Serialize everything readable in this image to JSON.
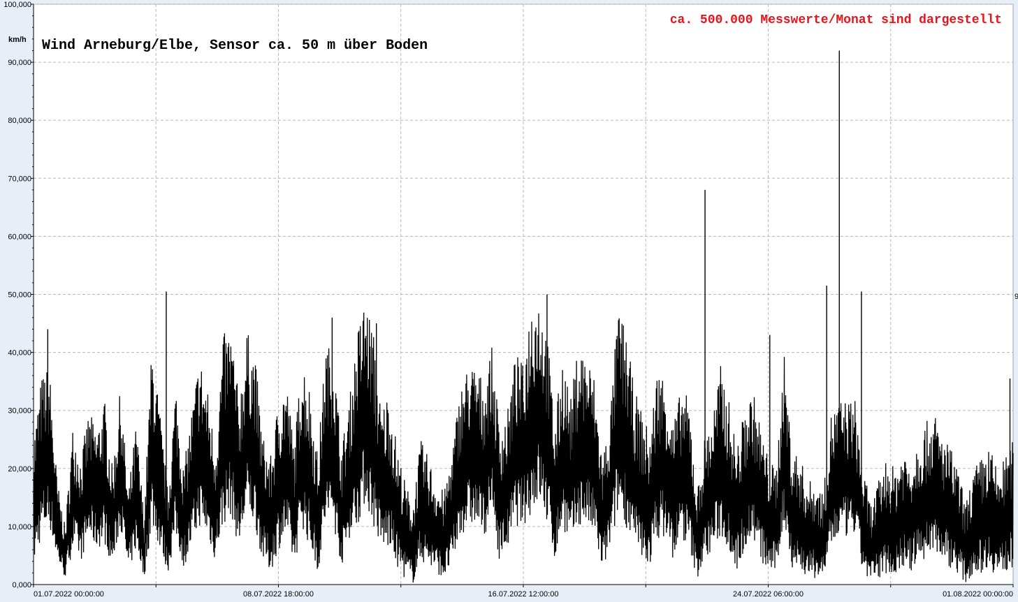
{
  "chart_data": {
    "type": "area",
    "title": "Wind  Arneburg/Elbe, Sensor ca. 50 m über Boden",
    "annotation": "ca. 500.000 Messwerte/Monat sind dargestellt",
    "ylabel": "km/h",
    "xlabel": "",
    "ylim": [
      0,
      100
    ],
    "y_ticks": [
      "0,000",
      "10,000",
      "20,000",
      "30,000",
      "40,000",
      "50,000",
      "60,000",
      "70,000",
      "80,000",
      "90,000",
      "100,000"
    ],
    "x_tick_labels": [
      "01.07.2022  00:00:00",
      "08.07.2022  18:00:00",
      "16.07.2022  12:00:00",
      "24.07.2022  06:00:00",
      "01.08.2022  00:00:00"
    ],
    "x_range_days": [
      0,
      31
    ],
    "grid": true,
    "series_color": "#000000",
    "series": [
      {
        "x_days": [
          0.0,
          0.25,
          0.5,
          0.75,
          1.0,
          1.25,
          1.5,
          1.75,
          2.0,
          2.25,
          2.5,
          2.75,
          3.0,
          3.25,
          3.5,
          3.75,
          4.0,
          4.25,
          4.5,
          4.75,
          5.0,
          5.25,
          5.5,
          5.75,
          6.0,
          6.25,
          6.5,
          6.75,
          7.0,
          7.25,
          7.5,
          7.75,
          8.0,
          8.25,
          8.5,
          8.75,
          9.0,
          9.25,
          9.5,
          9.75,
          10.0,
          10.25,
          10.5,
          10.75,
          11.0,
          11.25,
          11.5,
          11.75,
          12.0,
          12.25,
          12.5,
          12.75,
          13.0,
          13.25,
          13.5,
          13.75,
          14.0,
          14.25,
          14.5,
          14.75,
          15.0,
          15.25,
          15.5,
          15.75,
          16.0,
          16.25,
          16.5,
          16.75,
          17.0,
          17.25,
          17.5,
          17.75,
          18.0,
          18.25,
          18.5,
          18.75,
          19.0,
          19.25,
          19.5,
          19.75,
          20.0,
          20.25,
          20.5,
          20.75,
          21.0,
          21.25,
          21.5,
          21.75,
          22.0,
          22.25,
          22.5,
          22.75,
          23.0,
          23.25,
          23.5,
          23.75,
          24.0,
          24.25,
          24.5,
          24.75,
          25.0,
          25.25,
          25.5,
          25.75,
          26.0,
          26.25,
          26.5,
          26.75,
          27.0,
          27.25,
          27.5,
          27.75,
          28.0,
          28.25,
          28.5,
          28.75,
          29.0,
          29.25,
          29.5,
          29.75,
          30.0,
          30.25,
          30.5,
          30.75,
          31.0
        ],
        "upper": [
          26,
          36,
          38,
          18,
          10,
          28,
          22,
          30,
          27,
          32,
          20,
          34,
          16,
          28,
          12,
          42,
          30,
          16,
          35,
          20,
          30,
          40,
          34,
          24,
          43,
          45,
          32,
          44,
          40,
          26,
          22,
          32,
          36,
          24,
          40,
          34,
          22,
          42,
          40,
          24,
          32,
          44,
          50,
          44,
          30,
          34,
          24,
          18,
          14,
          25,
          22,
          18,
          16,
          24,
          34,
          38,
          38,
          35,
          41,
          28,
          30,
          40,
          38,
          50,
          51,
          44,
          28,
          40,
          32,
          42,
          40,
          36,
          22,
          30,
          48,
          44,
          34,
          30,
          26,
          38,
          36,
          28,
          34,
          32,
          16,
          26,
          30,
          38,
          32,
          24,
          30,
          34,
          28,
          22,
          20,
          40,
          24,
          22,
          18,
          18,
          16,
          30,
          32,
          32,
          32,
          20,
          14,
          18,
          22,
          20,
          24,
          22,
          26,
          28,
          30,
          26,
          24,
          20,
          14,
          20,
          22,
          24,
          20,
          22,
          25,
          35,
          28
        ],
        "lower": [
          3,
          8,
          10,
          4,
          1,
          6,
          4,
          8,
          6,
          7,
          3,
          10,
          2,
          6,
          1,
          10,
          6,
          2,
          8,
          3,
          6,
          10,
          8,
          4,
          10,
          12,
          6,
          12,
          10,
          4,
          2,
          6,
          8,
          3,
          10,
          6,
          2,
          10,
          10,
          3,
          8,
          10,
          14,
          10,
          6,
          6,
          3,
          1,
          0,
          4,
          3,
          2,
          1,
          3,
          8,
          10,
          10,
          8,
          12,
          4,
          6,
          10,
          10,
          12,
          14,
          10,
          4,
          10,
          6,
          10,
          10,
          8,
          2,
          6,
          12,
          10,
          6,
          4,
          3,
          8,
          8,
          4,
          8,
          6,
          1,
          4,
          6,
          8,
          6,
          2,
          6,
          8,
          4,
          2,
          2,
          10,
          3,
          2,
          1,
          1,
          1,
          6,
          8,
          8,
          8,
          2,
          0,
          1,
          2,
          1,
          3,
          2,
          4,
          4,
          6,
          4,
          3,
          2,
          0,
          2,
          2,
          3,
          1,
          2,
          3,
          8,
          4
        ]
      }
    ],
    "spikes": [
      {
        "day": 0.45,
        "value": 44
      },
      {
        "day": 4.2,
        "value": 50.5
      },
      {
        "day": 9.45,
        "value": 46
      },
      {
        "day": 10.85,
        "value": 45
      },
      {
        "day": 16.25,
        "value": 50
      },
      {
        "day": 21.25,
        "value": 68
      },
      {
        "day": 23.3,
        "value": 43
      },
      {
        "day": 25.1,
        "value": 51.5
      },
      {
        "day": 25.5,
        "value": 92
      },
      {
        "day": 26.2,
        "value": 50.5
      },
      {
        "day": 30.9,
        "value": 35.5
      }
    ],
    "right_edge_label": "9"
  }
}
